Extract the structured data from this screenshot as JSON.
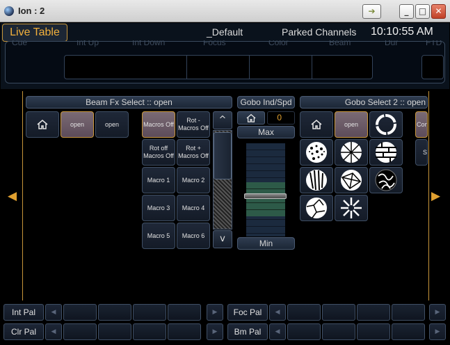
{
  "window": {
    "title": "Ion : 2",
    "icon": "app-globe-icon"
  },
  "header": {
    "live_table": "Live Table",
    "show_name": "_Default",
    "parked": "Parked Channels",
    "clock": "10:10:55 AM",
    "fader_columns": [
      "Cue",
      "Int Up",
      "Int Down",
      "Focus",
      "Color",
      "Beam",
      "Dur",
      "FTD"
    ]
  },
  "beam_fx": {
    "title": "Beam Fx Select :: open",
    "home_icon": "home-icon",
    "buttons": [
      "open",
      "open"
    ],
    "macros": [
      "Macros Off",
      "Rot - Macros Off",
      "Rot off Macros Off",
      "Rot + Macros Off",
      "Macro 1",
      "Macro 2",
      "Macro 3",
      "Macro 4",
      "Macro 5",
      "Macro 6"
    ],
    "scroll_up": "^",
    "scroll_down": "v"
  },
  "gobo_ind": {
    "title": "Gobo Ind/Spd",
    "value": "0",
    "max": "Max",
    "min": "Min",
    "level": 0.43
  },
  "gobo_select": {
    "title": "Gobo Select 2 :: open",
    "open_label": "open",
    "cut_labels": [
      "Con",
      "S"
    ],
    "gobos": [
      "ring-gobo-icon",
      "dots-gobo-icon",
      "breakup-gobo-icon",
      "bricks-gobo-icon",
      "stripes-gobo-icon",
      "shards-gobo-icon",
      "scribble-gobo-icon",
      "cracks-gobo-icon",
      "radial-gobo-icon"
    ]
  },
  "nav": {
    "left": "◀",
    "right": "▶"
  },
  "palettes": {
    "row1": [
      "Int Pal",
      "Foc Pal"
    ],
    "row2": [
      "Clr Pal",
      "Bm Pal"
    ],
    "arrow_left": "◀",
    "arrow_right": "▶"
  },
  "colors": {
    "accent": "#c8963a",
    "selected": "#6b5a66",
    "panel": "#1a2230"
  }
}
